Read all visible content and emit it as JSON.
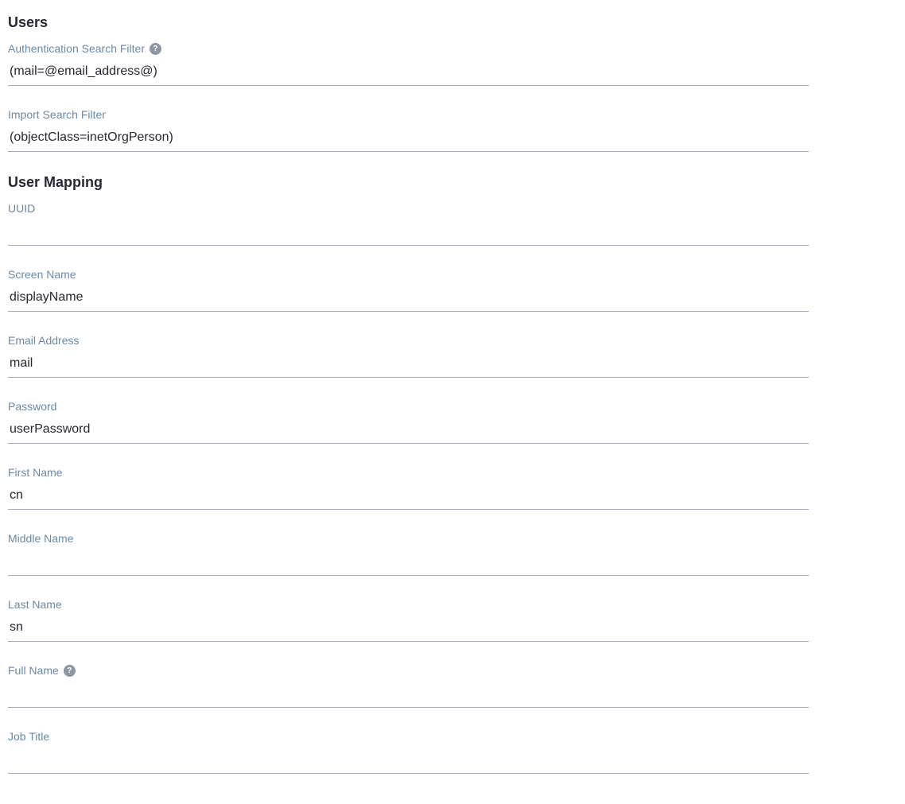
{
  "sections": {
    "users": {
      "heading": "Users",
      "authSearchFilter": {
        "label": "Authentication Search Filter",
        "hasHelp": true,
        "value": "(mail=@email_address@)"
      },
      "importSearchFilter": {
        "label": "Import Search Filter",
        "value": "(objectClass=inetOrgPerson)"
      }
    },
    "userMapping": {
      "heading": "User Mapping",
      "uuid": {
        "label": "UUID",
        "value": ""
      },
      "screenName": {
        "label": "Screen Name",
        "value": "displayName"
      },
      "emailAddress": {
        "label": "Email Address",
        "value": "mail"
      },
      "password": {
        "label": "Password",
        "value": "userPassword"
      },
      "firstName": {
        "label": "First Name",
        "value": "cn"
      },
      "middleName": {
        "label": "Middle Name",
        "value": ""
      },
      "lastName": {
        "label": "Last Name",
        "value": "sn"
      },
      "fullName": {
        "label": "Full Name",
        "hasHelp": true,
        "value": ""
      },
      "jobTitle": {
        "label": "Job Title",
        "value": ""
      }
    }
  }
}
